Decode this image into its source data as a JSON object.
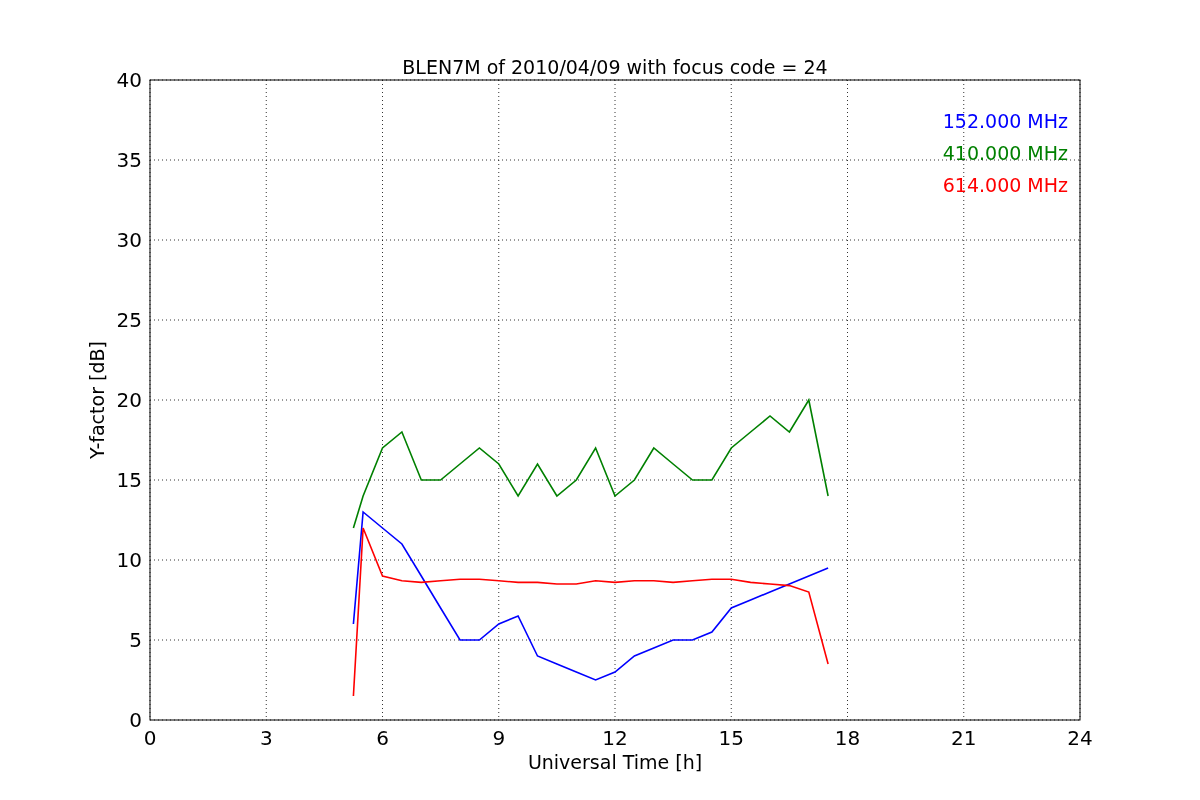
{
  "figure": {
    "chart_data": {
      "type": "line",
      "title": "BLEN7M of 2010/04/09 with focus code = 24",
      "xlabel": "Universal Time [h]",
      "ylabel": "Y-factor [dB]",
      "x": [
        5.25,
        5.5,
        6,
        6.5,
        7,
        7.5,
        8,
        8.5,
        9,
        9.5,
        10,
        10.5,
        11,
        11.5,
        12,
        12.5,
        13,
        13.5,
        14,
        14.5,
        15,
        15.5,
        16,
        16.5,
        17,
        17.5
      ],
      "series": [
        {
          "name": "152.000 MHz",
          "color": "#0000ff",
          "values": [
            6,
            13,
            12,
            11,
            9,
            7,
            5,
            5,
            6,
            6.5,
            4,
            3.5,
            3,
            2.5,
            3,
            4,
            4.5,
            5,
            5,
            5.5,
            7,
            7.5,
            8,
            8.5,
            9,
            9.5
          ]
        },
        {
          "name": "410.000 MHz",
          "color": "#008000",
          "values": [
            12,
            14,
            17,
            18,
            15,
            15,
            16,
            17,
            16,
            14,
            16,
            14,
            15,
            17,
            14,
            15,
            17,
            16,
            15,
            15,
            17,
            18,
            19,
            18,
            20,
            14
          ]
        },
        {
          "name": "614.000 MHz",
          "color": "#ff0000",
          "values": [
            1.5,
            12,
            9,
            8.7,
            8.6,
            8.7,
            8.8,
            8.8,
            8.7,
            8.6,
            8.6,
            8.5,
            8.5,
            8.7,
            8.6,
            8.7,
            8.7,
            8.6,
            8.7,
            8.8,
            8.8,
            8.6,
            8.5,
            8.4,
            8,
            3.5
          ]
        }
      ],
      "grid": true,
      "xlim": [
        0,
        24
      ],
      "ylim": [
        0,
        40
      ],
      "xticks": [
        0,
        3,
        6,
        9,
        12,
        15,
        18,
        21,
        24
      ],
      "yticks": [
        0,
        5,
        10,
        15,
        20,
        25,
        30,
        35,
        40
      ]
    }
  }
}
